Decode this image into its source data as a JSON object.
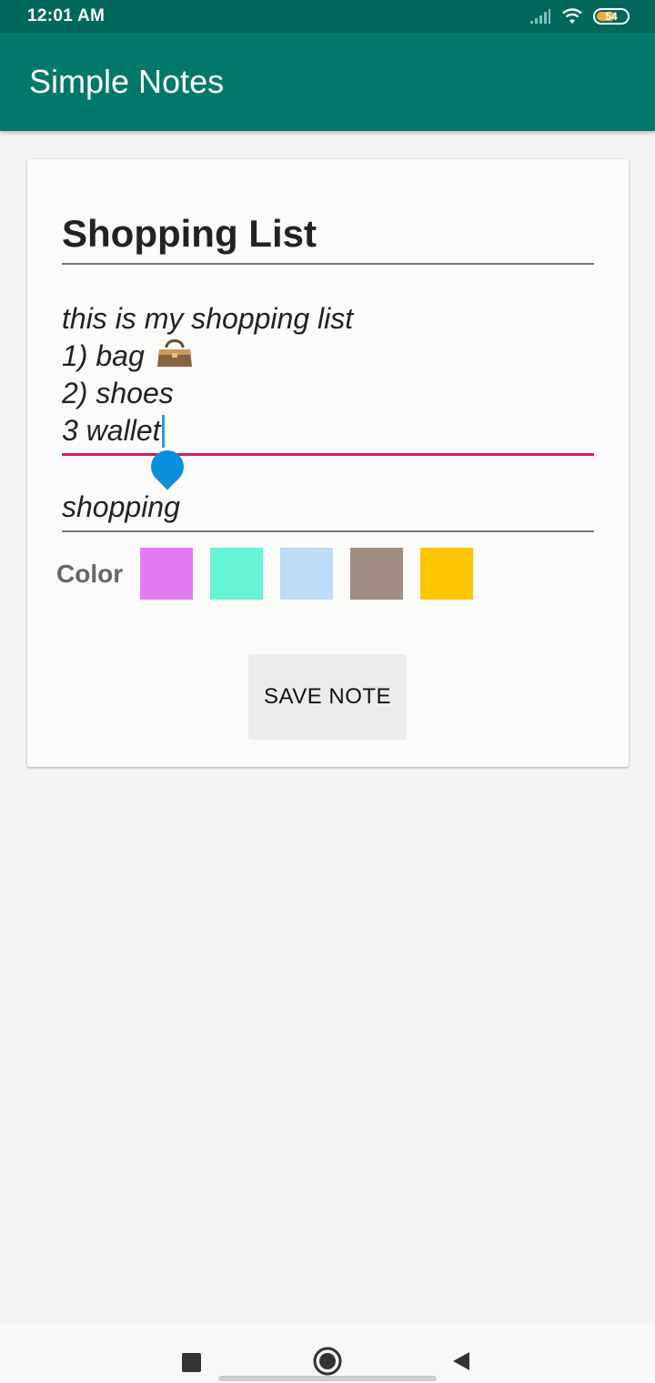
{
  "status_bar": {
    "time": "12:01 AM",
    "battery": "54"
  },
  "app_bar": {
    "title": "Simple Notes"
  },
  "note": {
    "title": "Shopping List",
    "body_lines": [
      "this is my shopping list",
      "1) bag",
      "2) shoes",
      "3 wallet"
    ],
    "tag": "shopping"
  },
  "color_picker": {
    "label": "Color",
    "swatches": [
      "#e27cf3",
      "#65f5d6",
      "#bcdcf7",
      "#a08b81",
      "#fdc400"
    ]
  },
  "save_button": {
    "label": "SAVE NOTE"
  },
  "icons": {
    "signal": "cell-signal-icon",
    "wifi": "wifi-icon",
    "battery": "battery-icon",
    "bag": "handbag-icon",
    "recent": "recent-apps-icon",
    "home": "home-icon",
    "back": "back-icon"
  },
  "colors": {
    "app_bar": "#00796b",
    "status_bar": "#00695c",
    "accent": "#d81b60",
    "cursor": "#0a8fdc"
  }
}
